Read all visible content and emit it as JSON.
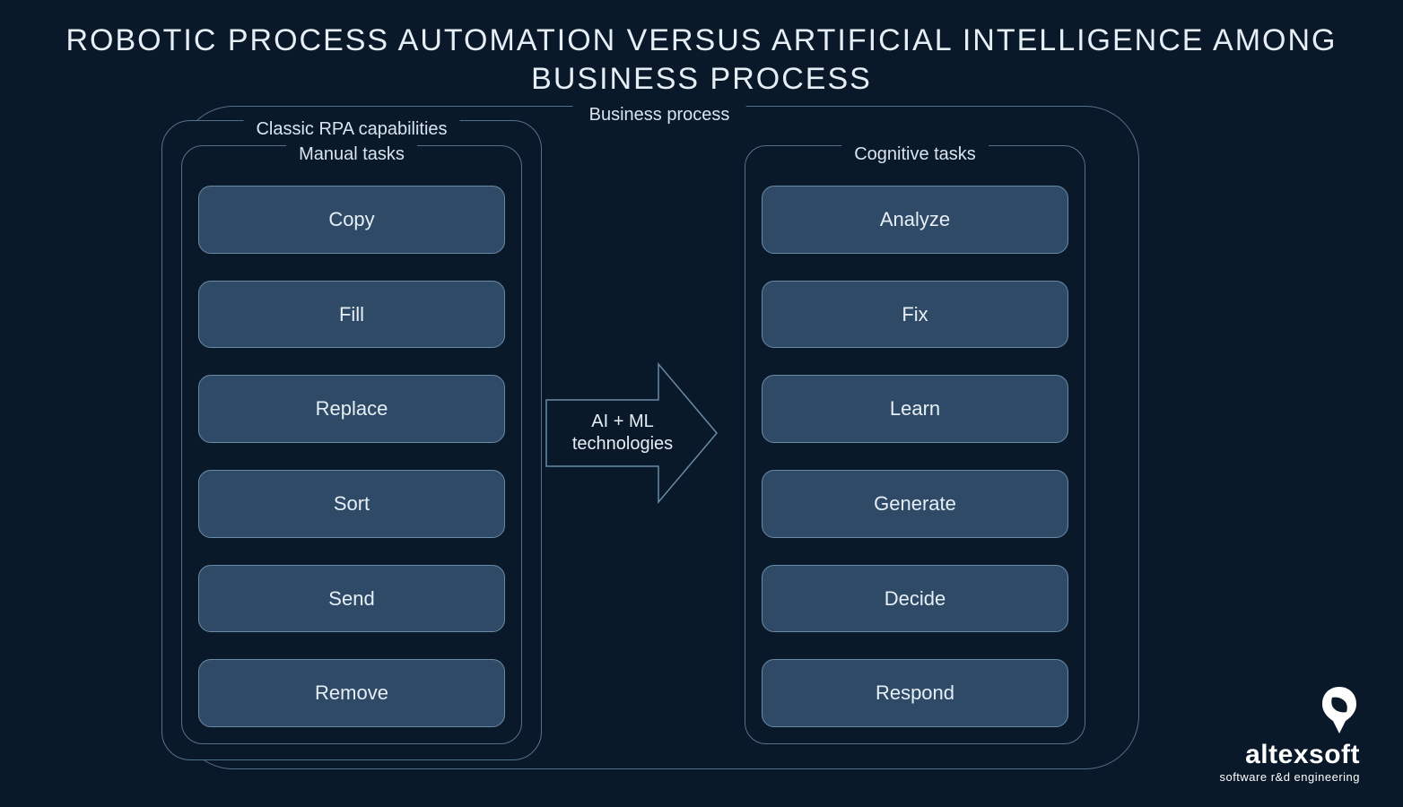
{
  "title": "ROBOTIC PROCESS AUTOMATION VERSUS ARTIFICIAL INTELLIGENCE AMONG BUSINESS PROCESS",
  "outer_label": "Business process",
  "rpa_label": "Classic RPA capabilities",
  "manual": {
    "label": "Manual tasks",
    "items": [
      "Copy",
      "Fill",
      "Replace",
      "Sort",
      "Send",
      "Remove"
    ]
  },
  "cognitive": {
    "label": "Cognitive tasks",
    "items": [
      "Analyze",
      "Fix",
      "Learn",
      "Generate",
      "Decide",
      "Respond"
    ]
  },
  "arrow": {
    "line1": "AI + ML",
    "line2": "technologies"
  },
  "brand": {
    "name": "altexsoft",
    "tag": "software r&d engineering"
  }
}
